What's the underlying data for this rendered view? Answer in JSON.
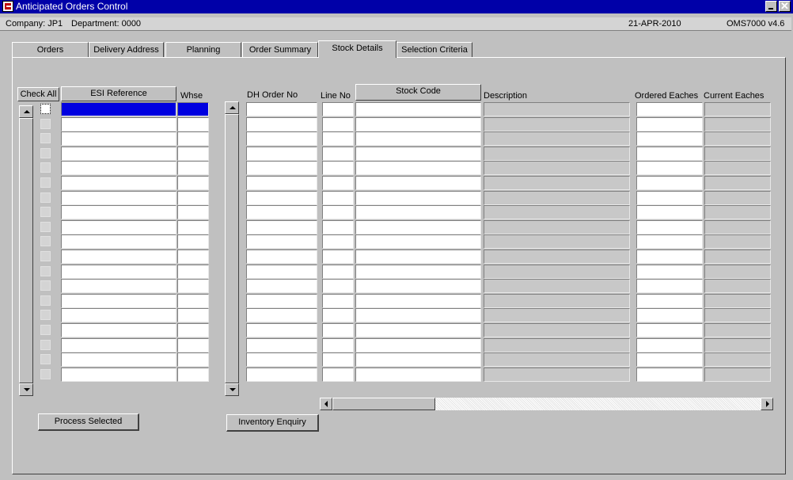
{
  "window": {
    "title": "Anticipated Orders Control",
    "minimize_glyph": "▁",
    "close_glyph": "✕"
  },
  "info": {
    "company": "Company:  JP1",
    "department": "Department:  0000",
    "date": "21-APR-2010",
    "version": "OMS7000  v4.6"
  },
  "tabs": [
    {
      "label": "Orders",
      "active": false
    },
    {
      "label": "Delivery Address",
      "active": false
    },
    {
      "label": "Planning",
      "active": false
    },
    {
      "label": "Order Summary",
      "active": false
    },
    {
      "label": "Stock Details",
      "active": true
    },
    {
      "label": "Selection Criteria",
      "active": false
    }
  ],
  "left_grid": {
    "check_all_label": "Check All",
    "esi_reference_label": "ESI Reference",
    "whse_label": "Whse",
    "row_count": 19,
    "selected_row": 1
  },
  "right_grid": {
    "dh_order_no_label": "DH Order No",
    "line_no_label": "Line No",
    "stock_code_label": "Stock Code",
    "description_label": "Description",
    "ordered_eaches_label": "Ordered Eaches",
    "current_eaches_label": "Current Eaches",
    "row_count": 19
  },
  "buttons": {
    "process_selected": "Process Selected",
    "inventory_enquiry": "Inventory Enquiry"
  },
  "colors": {
    "selection": "#0000e0",
    "titlebar": "#0000a8"
  }
}
